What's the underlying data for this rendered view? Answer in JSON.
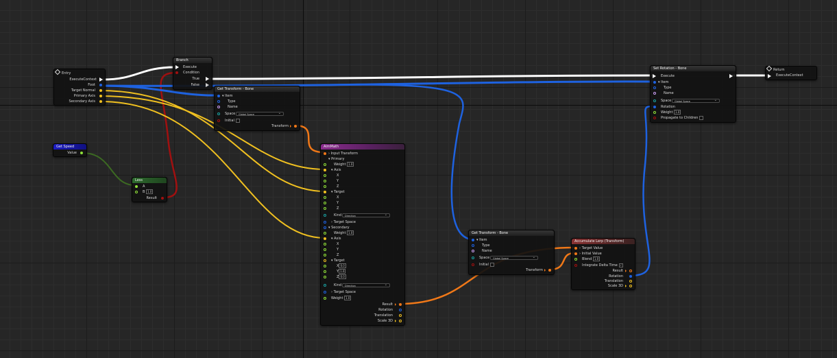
{
  "colors": {
    "exec": "#ffffff",
    "bone": "#1d6ff0",
    "vector": "#f0c020",
    "float": "#8fe038",
    "transform": "#f07818",
    "bool": "#9a1010",
    "rotation": "#7aa6f8",
    "name": "#c89cf0",
    "space": "#1aa0a0"
  },
  "nodes": {
    "entry": {
      "title": "Entry",
      "pins": [
        "ExecuteContext",
        "Foot",
        "Target Normal",
        "Primary Axis",
        "Secondary Axis"
      ]
    },
    "branch": {
      "title": "Branch",
      "pins": [
        "Execute",
        "Condition",
        "True",
        "False"
      ]
    },
    "get_speed": {
      "title": "Get Speed",
      "value_label": "Value"
    },
    "less": {
      "title": "Less",
      "a_label": "A",
      "b_label": "B",
      "b_value": "1.0",
      "result_label": "Result"
    },
    "get_transform_1": {
      "title": "Get Transform - Bone",
      "item": "Item",
      "type": "Type",
      "name": "Name",
      "space_label": "Space",
      "space_value": "Global Space",
      "initial": "Initial",
      "transform": "Transform"
    },
    "aim_math": {
      "title": "AimMath",
      "input_transform": "Input Transform",
      "primary": "Primary",
      "weight": "Weight",
      "weight_value": "1.0",
      "axis": "Axis",
      "x": "X",
      "y": "Y",
      "z": "Z",
      "target": "Target",
      "kind": "Kind",
      "kind_value": "Direction",
      "target_space": "Target Space",
      "secondary": "Secondary",
      "sec_x": "0.0",
      "sec_y": "1.0",
      "sec_z": "0.0",
      "result": "Result",
      "rotation": "Rotation",
      "translation": "Translation",
      "scale": "Scale 3D"
    },
    "get_transform_2": {
      "title": "Get Transform - Bone",
      "item": "Item",
      "type": "Type",
      "name": "Name",
      "space_label": "Space",
      "space_value": "Global Space",
      "initial": "Initial",
      "transform": "Transform"
    },
    "accumulate": {
      "title": "Accumulate Lerp (Transform)",
      "target_value": "Target Value",
      "initial_value": "Initial Value",
      "blend": "Blend",
      "blend_value": "1.0",
      "integrate": "Integrate Delta Time",
      "result": "Result",
      "rotation": "Rotation",
      "translation": "Translation",
      "scale": "Scale 3D"
    },
    "set_rotation": {
      "title": "Set Rotation - Bone",
      "execute": "Execute",
      "item": "Item",
      "type": "Type",
      "name": "Name",
      "space_label": "Space",
      "space_value": "Global Space",
      "rotation": "Rotation",
      "weight": "Weight",
      "weight_value": "1.0",
      "propagate": "Propagate to Children"
    },
    "return": {
      "title": "Return",
      "pin": "ExecuteContext"
    }
  }
}
